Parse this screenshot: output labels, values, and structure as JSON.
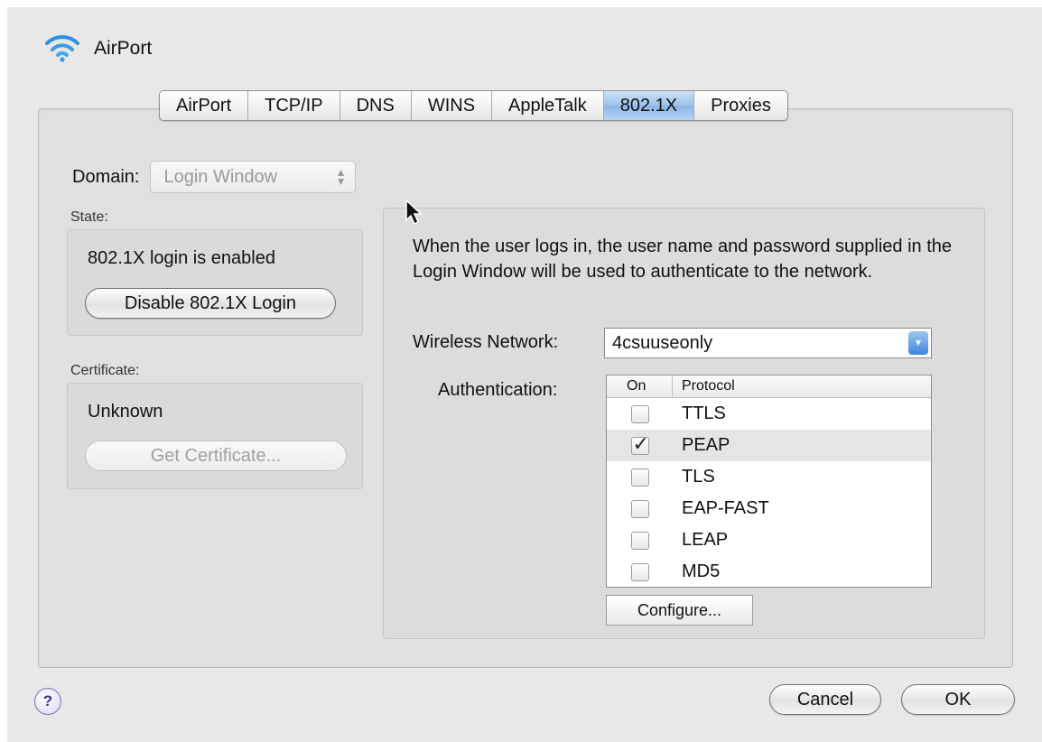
{
  "window": {
    "title": "AirPort",
    "icon": "wifi-icon"
  },
  "tabs": [
    {
      "label": "AirPort",
      "selected": false
    },
    {
      "label": "TCP/IP",
      "selected": false
    },
    {
      "label": "DNS",
      "selected": false
    },
    {
      "label": "WINS",
      "selected": false
    },
    {
      "label": "AppleTalk",
      "selected": false
    },
    {
      "label": "802.1X",
      "selected": true
    },
    {
      "label": "Proxies",
      "selected": false
    }
  ],
  "domain": {
    "label": "Domain:",
    "value": "Login Window"
  },
  "state": {
    "caption": "State:",
    "text": "802.1X login is enabled",
    "button": "Disable 802.1X Login"
  },
  "certificate": {
    "caption": "Certificate:",
    "text": "Unknown",
    "button": "Get Certificate..."
  },
  "login_info": {
    "description": "When the user logs in, the user name and password supplied in the Login Window will be used to authenticate to the network.",
    "wireless_label": "Wireless Network:",
    "wireless_value": "4csuuseonly",
    "auth_label": "Authentication:",
    "auth_columns": {
      "on": "On",
      "protocol": "Protocol"
    },
    "protocols": [
      {
        "name": "TTLS",
        "on": false
      },
      {
        "name": "PEAP",
        "on": true
      },
      {
        "name": "TLS",
        "on": false
      },
      {
        "name": "EAP-FAST",
        "on": false
      },
      {
        "name": "LEAP",
        "on": false
      },
      {
        "name": "MD5",
        "on": false
      }
    ],
    "configure_button": "Configure..."
  },
  "footer": {
    "help": "?",
    "cancel": "Cancel",
    "ok": "OK"
  },
  "colors": {
    "selected_tab": "#9cc0ea",
    "background": "#e8e8e8"
  }
}
